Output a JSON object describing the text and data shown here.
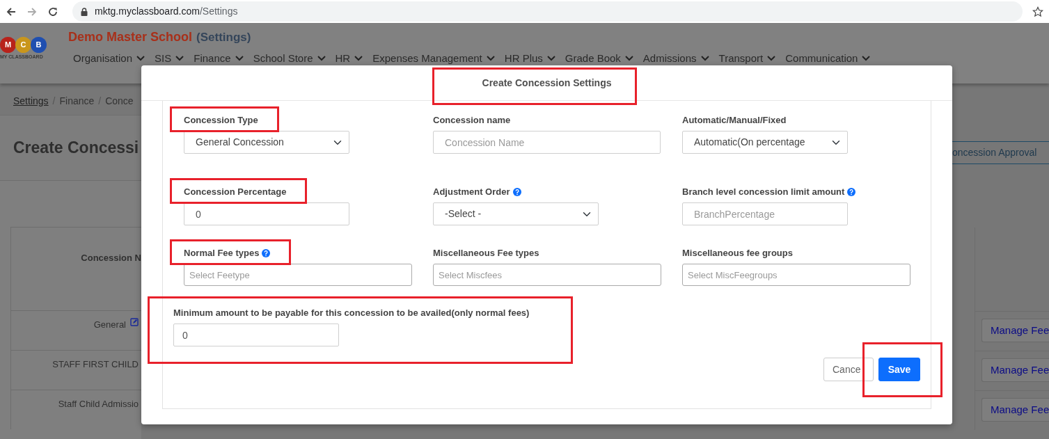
{
  "browser": {
    "host": "mktg.myclassboard.com",
    "path": "/Settings"
  },
  "header": {
    "logo_letters": [
      "M",
      "C",
      "B"
    ],
    "logo_caption": "MY CLASSBOARD",
    "school": "Demo Master School",
    "section": "(Settings)",
    "nav": [
      "Organisation",
      "SIS",
      "Finance",
      "School Store",
      "HR",
      "Expenses Management",
      "HR Plus",
      "Grade Book",
      "Admissions",
      "Transport",
      "Communication"
    ]
  },
  "breadcrumb": {
    "separator": "/",
    "items": [
      {
        "label": "Settings",
        "link": true
      },
      {
        "label": "Finance",
        "link": false
      },
      {
        "label": "Conce",
        "link": false
      }
    ]
  },
  "heading": "Create Concessi",
  "approval_button": "oncession Approval",
  "table": {
    "header": "Concession N",
    "rows": [
      {
        "name": "General",
        "edit_icon": true,
        "action": "Manage Fee"
      },
      {
        "name": "STAFF FIRST CHILD",
        "edit_icon": false,
        "action": "Manage Fee"
      },
      {
        "name": "Staff Child Admissio",
        "edit_icon": false,
        "action": "Manage Fee"
      }
    ]
  },
  "modal": {
    "title": "Create Concession Settings",
    "title_highlighted": true,
    "fields": [
      {
        "kind": "select",
        "label": "Concession Type",
        "help": false,
        "highlighted": true,
        "value": "General Concession"
      },
      {
        "kind": "input",
        "label": "Concession name",
        "help": false,
        "highlighted": false,
        "placeholder": "Concession Name"
      },
      {
        "kind": "select",
        "label": "Automatic/Manual/Fixed",
        "help": false,
        "highlighted": false,
        "value": "Automatic(On percentage"
      },
      {
        "kind": "input",
        "label": "Concession Percentage",
        "help": false,
        "highlighted": true,
        "value": "0"
      },
      {
        "kind": "select",
        "label": "Adjustment Order",
        "help": true,
        "highlighted": false,
        "value": "-Select -"
      },
      {
        "kind": "input",
        "label": "Branch level concession limit amount",
        "help": true,
        "highlighted": false,
        "placeholder": "BranchPercentage"
      },
      {
        "kind": "input",
        "label": "Normal Fee types",
        "help": true,
        "highlighted": true,
        "placeholder": "Select Feetype"
      },
      {
        "kind": "input",
        "label": "Miscellaneous Fee types",
        "help": false,
        "highlighted": false,
        "placeholder": "Select Miscfees"
      },
      {
        "kind": "input",
        "label": "Miscellaneous fee groups",
        "help": false,
        "highlighted": false,
        "placeholder": "Select MiscFeegroups"
      }
    ],
    "minimum": {
      "label": "Minimum amount to be payable for this concession to be availed(only normal fees)",
      "value": "0",
      "highlighted": true
    },
    "buttons": [
      {
        "kind": "secondary",
        "label": "Cance",
        "highlighted": false
      },
      {
        "kind": "primary",
        "label": "Save",
        "highlighted": true
      }
    ]
  }
}
